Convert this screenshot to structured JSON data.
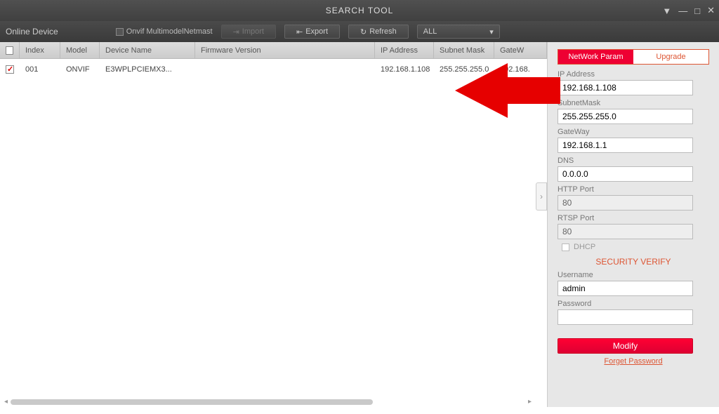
{
  "titlebar": {
    "title": "SEARCH TOOL"
  },
  "toolbar": {
    "online_device": "Online Device",
    "onvif_check": "Onvif MultimodelNetmast",
    "import": "Import",
    "export": "Export",
    "refresh": "Refresh",
    "filter": "ALL"
  },
  "table": {
    "headers": {
      "index": "Index",
      "model": "Model",
      "device_name": "Device Name",
      "firmware": "Firmware Version",
      "ip": "IP Address",
      "subnet": "Subnet Mask",
      "gateway": "GateW"
    },
    "rows": [
      {
        "index": "001",
        "model": "ONVIF",
        "device_name": "E3WPLPCIEMX3...",
        "firmware": "",
        "ip": "192.168.1.108",
        "subnet": "255.255.255.0",
        "gateway": "192.168."
      }
    ]
  },
  "right": {
    "tabs": {
      "network": "NetWork Param",
      "upgrade": "Upgrade"
    },
    "form": {
      "ip_label": "IP Address",
      "ip": "192.168.1.108",
      "subnet_label": "SubnetMask",
      "subnet": "255.255.255.0",
      "gateway_label": "GateWay",
      "gateway": "192.168.1.1",
      "dns_label": "DNS",
      "dns": "0.0.0.0",
      "http_label": "HTTP Port",
      "http": "80",
      "rtsp_label": "RTSP Port",
      "rtsp": "80",
      "dhcp": "DHCP",
      "security": "SECURITY VERIFY",
      "user_label": "Username",
      "user": "admin",
      "pass_label": "Password",
      "pass": "",
      "modify": "Modify",
      "forget": "Forget Password"
    }
  }
}
